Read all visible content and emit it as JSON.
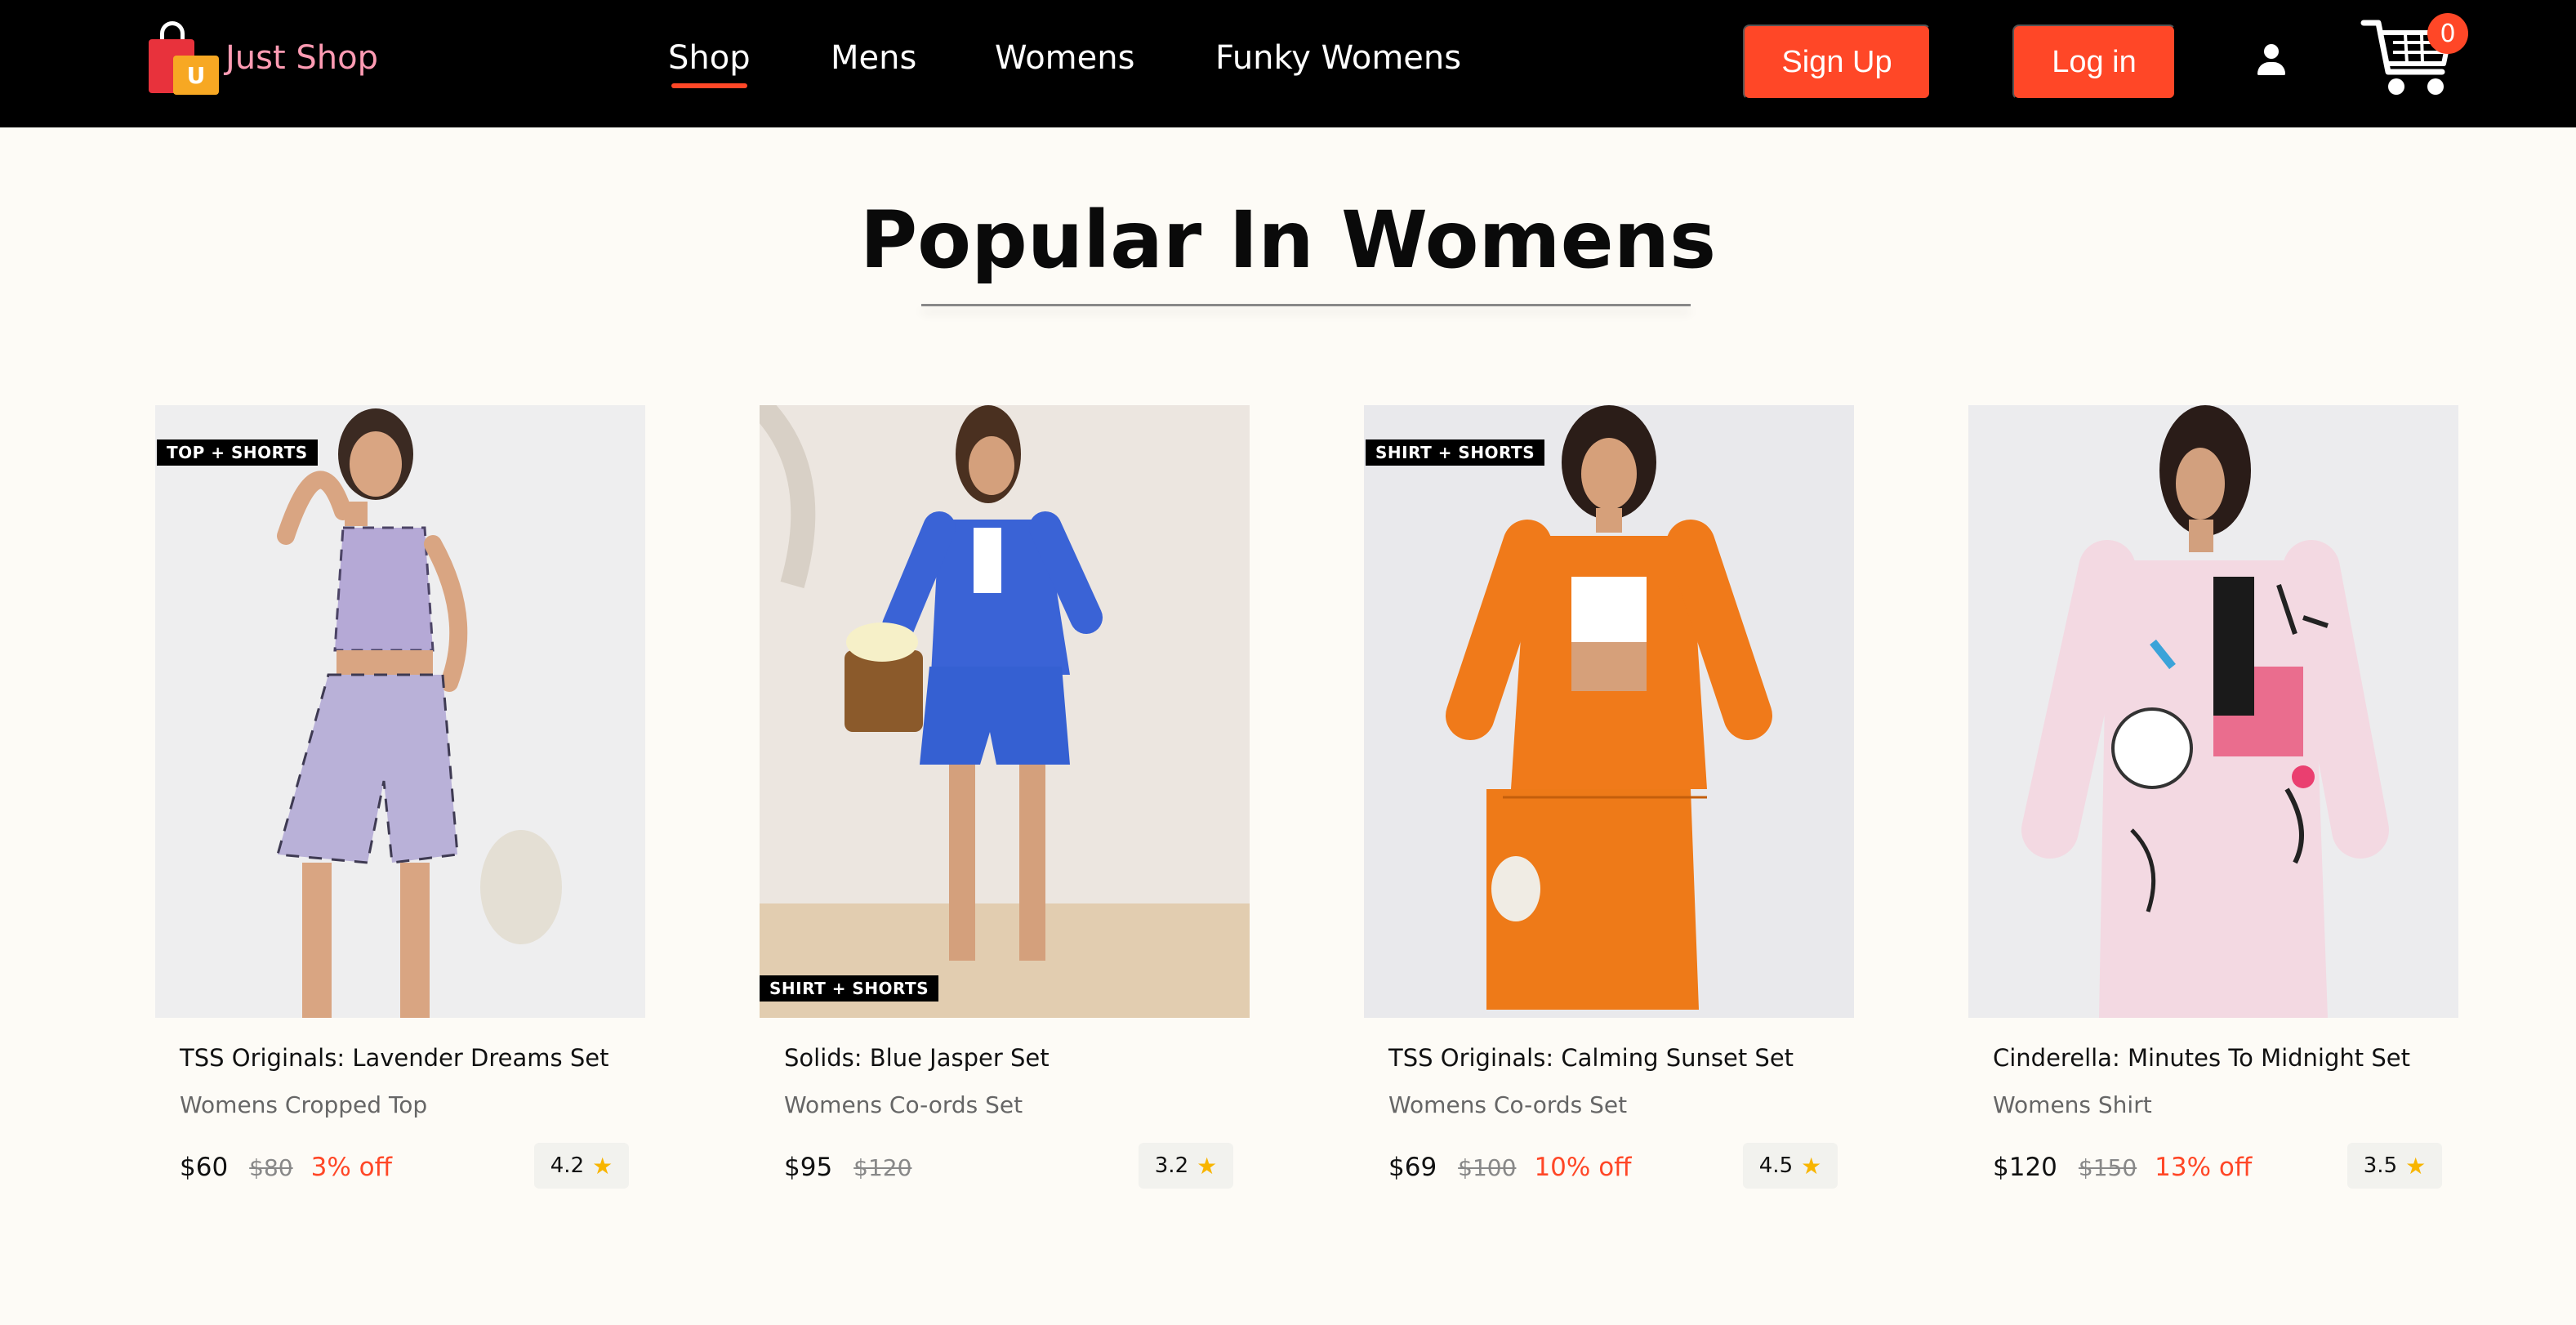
{
  "brand": {
    "name": "Just Shop",
    "badge_letter": "U"
  },
  "nav": {
    "links": [
      "Shop",
      "Mens",
      "Womens",
      "Funky Womens"
    ],
    "active": "Shop",
    "signup_label": "Sign Up",
    "login_label": "Log in",
    "cart_count": "0",
    "accent_color": "#ff4727"
  },
  "section": {
    "title": "Popular In Womens"
  },
  "products": [
    {
      "tag": "TOP + SHORTS",
      "name": "TSS Originals: Lavender Dreams Set",
      "category": "Womens Cropped Top",
      "price": "$60",
      "old_price": "$80",
      "discount": "3% off",
      "rating": "4.2"
    },
    {
      "tag": "SHIRT + SHORTS",
      "name": "Solids: Blue Jasper Set",
      "category": "Womens Co-ords Set",
      "price": "$95",
      "old_price": "$120",
      "discount": "",
      "rating": "3.2"
    },
    {
      "tag": "SHIRT + SHORTS",
      "name": "TSS Originals: Calming Sunset Set",
      "category": "Womens Co-ords Set",
      "price": "$69",
      "old_price": "$100",
      "discount": "10% off",
      "rating": "4.5"
    },
    {
      "tag": "",
      "name": "Cinderella: Minutes To Midnight Set",
      "category": "Womens Shirt",
      "price": "$120",
      "old_price": "$150",
      "discount": "13% off",
      "rating": "3.5"
    }
  ]
}
